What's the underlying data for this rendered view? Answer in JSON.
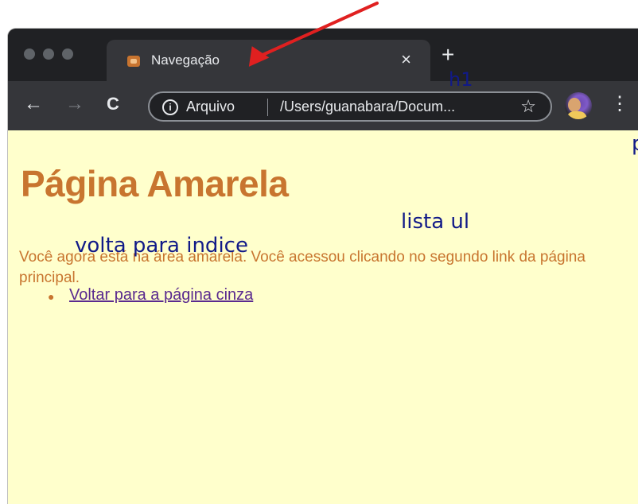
{
  "browser": {
    "tab": {
      "title": "Navegação",
      "close_icon": "×"
    },
    "new_tab_icon": "+",
    "toolbar": {
      "back_icon": "←",
      "forward_icon": "→",
      "reload_icon": "C",
      "scheme_label": "Arquivo",
      "url": "/Users/guanabara/Docum...",
      "star_icon": "☆",
      "menu_icon": "⋮"
    }
  },
  "page": {
    "heading": "Página Amarela",
    "paragraph": "Você agora está na área amarela. Você acessou clicando no segundo link da página principal.",
    "list": [
      {
        "link": "Voltar para a página cinza"
      }
    ]
  },
  "annotations": {
    "h1": "h1",
    "p": "p",
    "ul": "lista ul",
    "link_note": "volta para indice"
  },
  "colors": {
    "page_background": "#ffffcc",
    "heading": "#c8752f",
    "annotation": "#111a88",
    "arrow": "#e02020"
  }
}
